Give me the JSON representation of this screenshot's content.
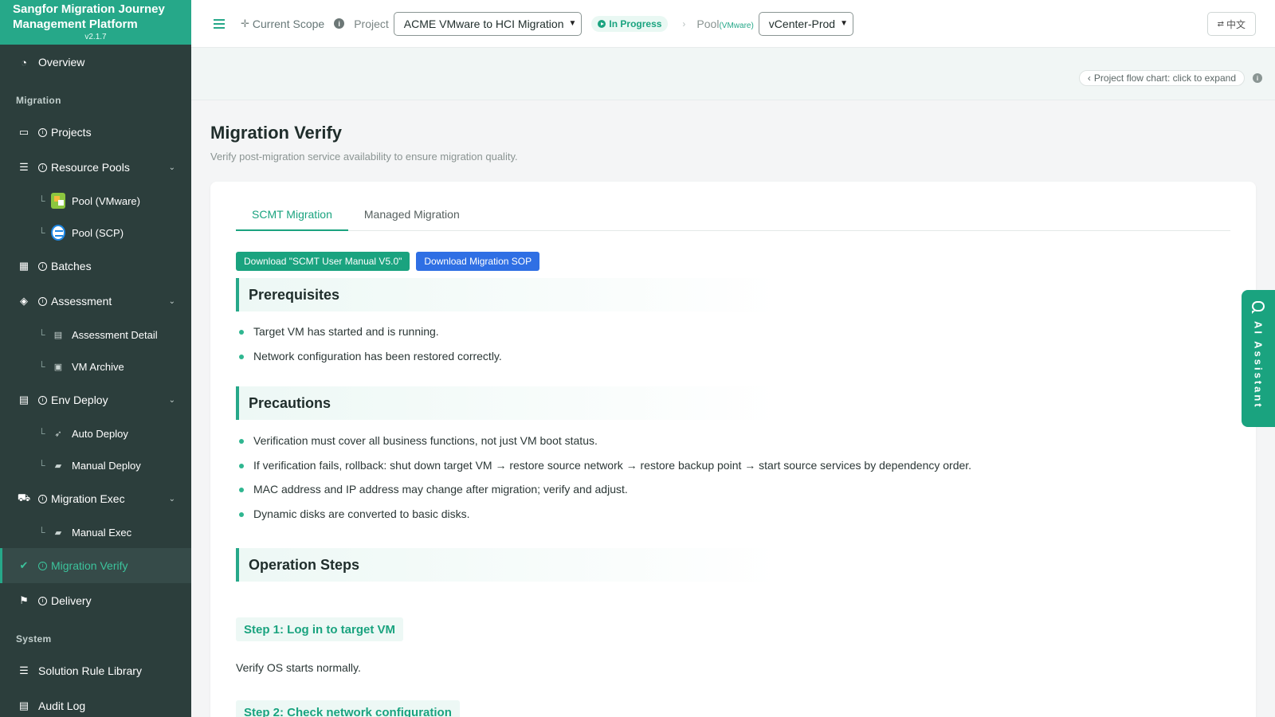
{
  "app": {
    "title": "Sangfor Migration Journey Management Platform",
    "version": "v2.1.7"
  },
  "sidebar": {
    "overview": "Overview",
    "section_migration": "Migration",
    "projects": "Projects",
    "resource_pools": "Resource Pools",
    "pool_vmware": "Pool (VMware)",
    "pool_scp": "Pool (SCP)",
    "batches": "Batches",
    "assessment": "Assessment",
    "assessment_detail": "Assessment Detail",
    "vm_archive": "VM Archive",
    "env_deploy": "Env Deploy",
    "auto_deploy": "Auto Deploy",
    "manual_deploy": "Manual Deploy",
    "migration_exec": "Migration Exec",
    "manual_exec": "Manual Exec",
    "migration_verify": "Migration Verify",
    "delivery": "Delivery",
    "section_system": "System",
    "solution_rule_library": "Solution Rule Library",
    "audit_log": "Audit Log"
  },
  "topbar": {
    "scope_label": "Current Scope",
    "project_label": "Project",
    "project_value": "ACME VMware to HCI Migration",
    "status": "In Progress",
    "pool_label": "Pool",
    "pool_type": "(VMware)",
    "pool_value": "vCenter-Prod",
    "language": "中文"
  },
  "flowbar": {
    "expand_label": "Project flow chart: click to expand"
  },
  "page": {
    "title": "Migration Verify",
    "subtitle": "Verify post-migration service availability to ensure migration quality."
  },
  "tabs": [
    "SCMT Migration",
    "Managed Migration"
  ],
  "downloads": {
    "manual": "Download \"SCMT User Manual V5.0\"",
    "sop": "Download Migration SOP"
  },
  "prerequisites": {
    "title": "Prerequisites",
    "items": [
      "Target VM has started and is running.",
      "Network configuration has been restored correctly."
    ]
  },
  "precautions": {
    "title": "Precautions",
    "items": [
      "Verification must cover all business functions, not just VM boot status.",
      "If verification fails, rollback: shut down target VM → restore source network → restore backup point → start source services by dependency order.",
      "MAC address and IP address may change after migration; verify and adjust.",
      "Dynamic disks are converted to basic disks."
    ]
  },
  "operation_steps": {
    "title": "Operation Steps",
    "step1_title": "Step 1: Log in to target VM",
    "step1_text": "Verify OS starts normally.",
    "step2_title": "Step 2: Check network configuration"
  },
  "assistant": {
    "label": "AI Assistant"
  },
  "colors": {
    "brand": "#26a889",
    "sidebar": "#2c3e3c",
    "accent_blue": "#2f6fe4"
  }
}
